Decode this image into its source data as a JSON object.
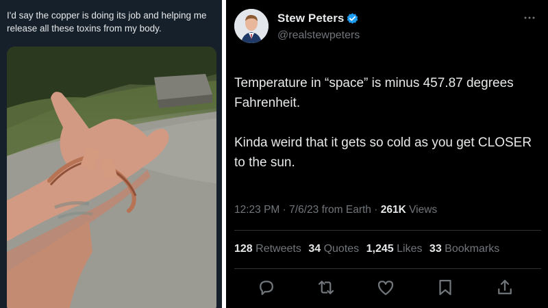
{
  "left_post": {
    "caption": "I'd say the copper is doing its job and helping me release all these toxins from my body."
  },
  "tweet": {
    "author": {
      "name": "Stew Peters",
      "handle": "@realstewpeters",
      "verified": true
    },
    "text_paragraphs": [
      "Temperature in “space” is minus 457.87 degrees Fahrenheit.",
      "Kinda weird that it gets so cold as you get CLOSER to the sun."
    ],
    "time": "12:23 PM",
    "date": "7/6/23",
    "source": "from Earth",
    "views_count": "261K",
    "views_label": "Views",
    "stats": [
      {
        "count": "128",
        "label": "Retweets"
      },
      {
        "count": "34",
        "label": "Quotes"
      },
      {
        "count": "1,245",
        "label": "Likes"
      },
      {
        "count": "33",
        "label": "Bookmarks"
      }
    ],
    "actions": [
      "reply-icon",
      "retweet-icon",
      "like-icon",
      "bookmark-icon",
      "share-icon"
    ]
  },
  "colors": {
    "left_background": "#15202b",
    "tweet_background": "#000000",
    "primary_text": "#e7e9ea",
    "secondary_text": "#71767b",
    "verified_blue": "#1d9bf0",
    "copper": "#b87355"
  }
}
